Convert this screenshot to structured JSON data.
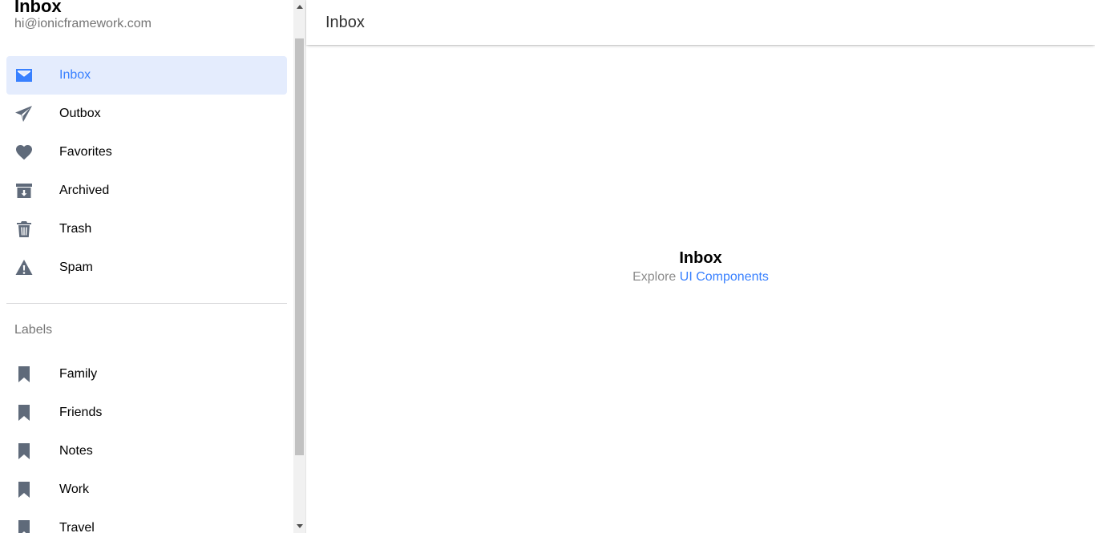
{
  "menu": {
    "title": "Inbox",
    "email": "hi@ionicframework.com",
    "pages": [
      {
        "label": "Inbox",
        "icon": "mail-icon",
        "selected": true
      },
      {
        "label": "Outbox",
        "icon": "paper-plane-icon",
        "selected": false
      },
      {
        "label": "Favorites",
        "icon": "heart-icon",
        "selected": false
      },
      {
        "label": "Archived",
        "icon": "archive-icon",
        "selected": false
      },
      {
        "label": "Trash",
        "icon": "trash-icon",
        "selected": false
      },
      {
        "label": "Spam",
        "icon": "warning-icon",
        "selected": false
      }
    ],
    "labels_header": "Labels",
    "labels": [
      {
        "label": "Family",
        "icon": "bookmark-icon"
      },
      {
        "label": "Friends",
        "icon": "bookmark-icon"
      },
      {
        "label": "Notes",
        "icon": "bookmark-icon"
      },
      {
        "label": "Work",
        "icon": "bookmark-icon"
      },
      {
        "label": "Travel",
        "icon": "bookmark-icon"
      }
    ]
  },
  "toolbar": {
    "title": "Inbox"
  },
  "content": {
    "title": "Inbox",
    "explore_text": "Explore",
    "link_text": "UI Components"
  },
  "colors": {
    "accent": "#3880ff",
    "selected_bg": "#e4ecfd",
    "icon": "#5f6a7a"
  }
}
